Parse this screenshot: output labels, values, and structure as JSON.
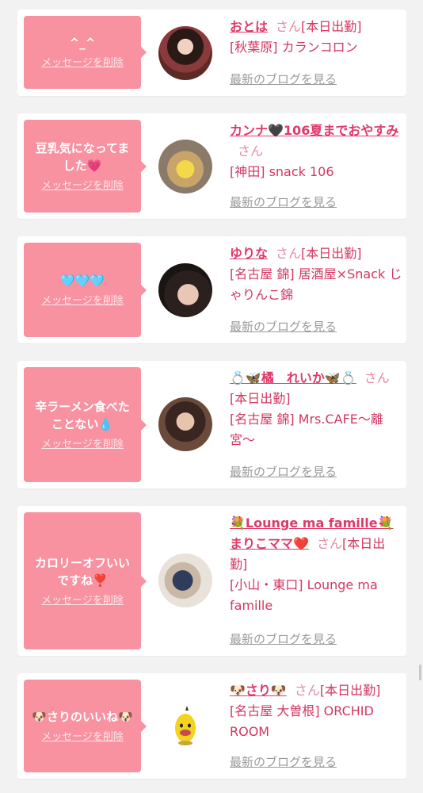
{
  "delete_label": "メッセージを削除",
  "blog_label": "最新のブログを見る",
  "san_label": "さん",
  "cards": [
    {
      "message": "^_^",
      "name": "おとは",
      "status": "[本日出勤]",
      "place": "[秋葉原] カランコロン"
    },
    {
      "message": "豆乳気になってました💗",
      "name": "カンナ🖤106夏までおやすみ",
      "status": "",
      "place": "[神田] snack 106"
    },
    {
      "message": "🩵🩵🩵",
      "name": "ゆりな",
      "status": "[本日出勤]",
      "place": "[名古屋 錦] 居酒屋×Snack じゃりんこ錦"
    },
    {
      "message": "辛ラーメン食べたことない💧",
      "name": "💍🦋橘　れいか🦋💍",
      "status": "[本日出勤]",
      "place": "[名古屋 錦] Mrs.CAFE〜離宮〜"
    },
    {
      "message": "カロリーオフいいですね❣️",
      "name": "💐Lounge ma famille💐まりこママ❤️",
      "status": "[本日出勤]",
      "place": "[小山・東口] Lounge ma famille"
    },
    {
      "message": "🐶さりのいいね🐶",
      "name": "🐶さり🐶",
      "status": "[本日出勤]",
      "place": "[名古屋 大曽根] ORCHID ROOM"
    }
  ]
}
